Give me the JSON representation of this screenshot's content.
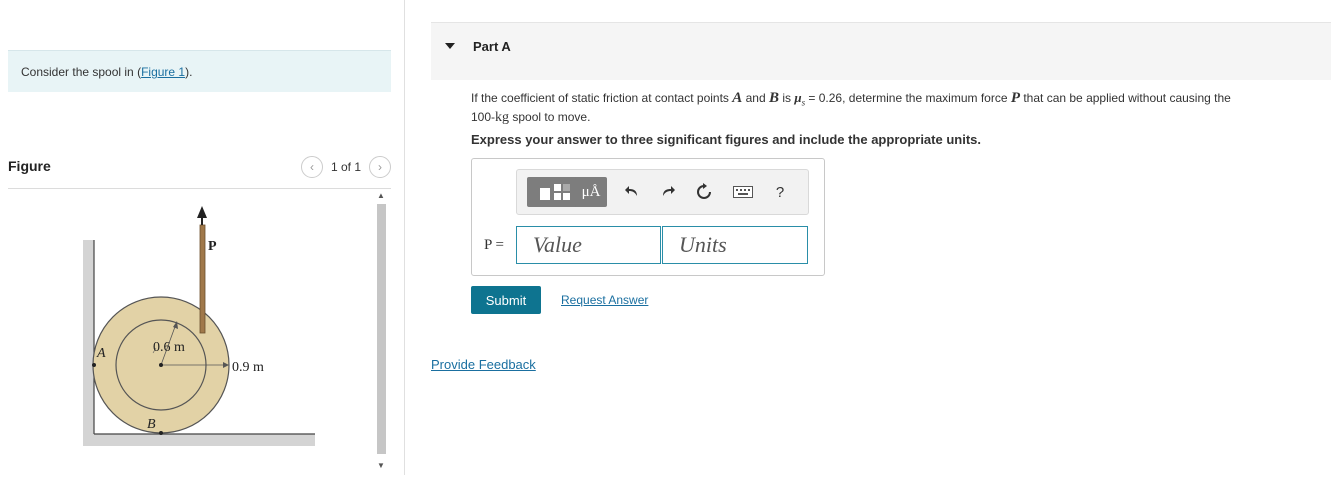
{
  "intro": {
    "text_before": "Consider the spool in (",
    "link_label": "Figure 1",
    "text_after": ")."
  },
  "figure_panel": {
    "title": "Figure",
    "pager": "1 of 1",
    "prev_icon": "chevron-left-icon",
    "next_icon": "chevron-right-icon",
    "labels": {
      "force": "P",
      "point_a": "A",
      "point_b": "B",
      "inner_radius": "0.6 m",
      "outer_radius": "0.9 m"
    }
  },
  "part": {
    "title": "Part A",
    "question": {
      "t1": "If the coefficient of static friction at contact points ",
      "a": "A",
      "t2": " and ",
      "b": "B",
      "t3": " is ",
      "mu": "μ",
      "mu_sub": "s",
      "t4": " = 0.26, determine the maximum force ",
      "p": "P",
      "t5": " that can be applied without causing the",
      "mass_num": "100-",
      "mass_unit": "kg",
      "t6": " spool to move."
    },
    "instruction": "Express your answer to three significant figures and include the appropriate units.",
    "answer": {
      "label": "P =",
      "value_placeholder": "Value",
      "units_placeholder": "Units",
      "toolbar": {
        "units_symbol": "μÅ",
        "help": "?"
      }
    },
    "submit_label": "Submit",
    "request_label": "Request Answer"
  },
  "feedback_label": "Provide Feedback",
  "colors": {
    "accent": "#0e7490",
    "link": "#1a6fa0",
    "spool_fill": "#e2d2a6",
    "rope": "#a0784a"
  }
}
